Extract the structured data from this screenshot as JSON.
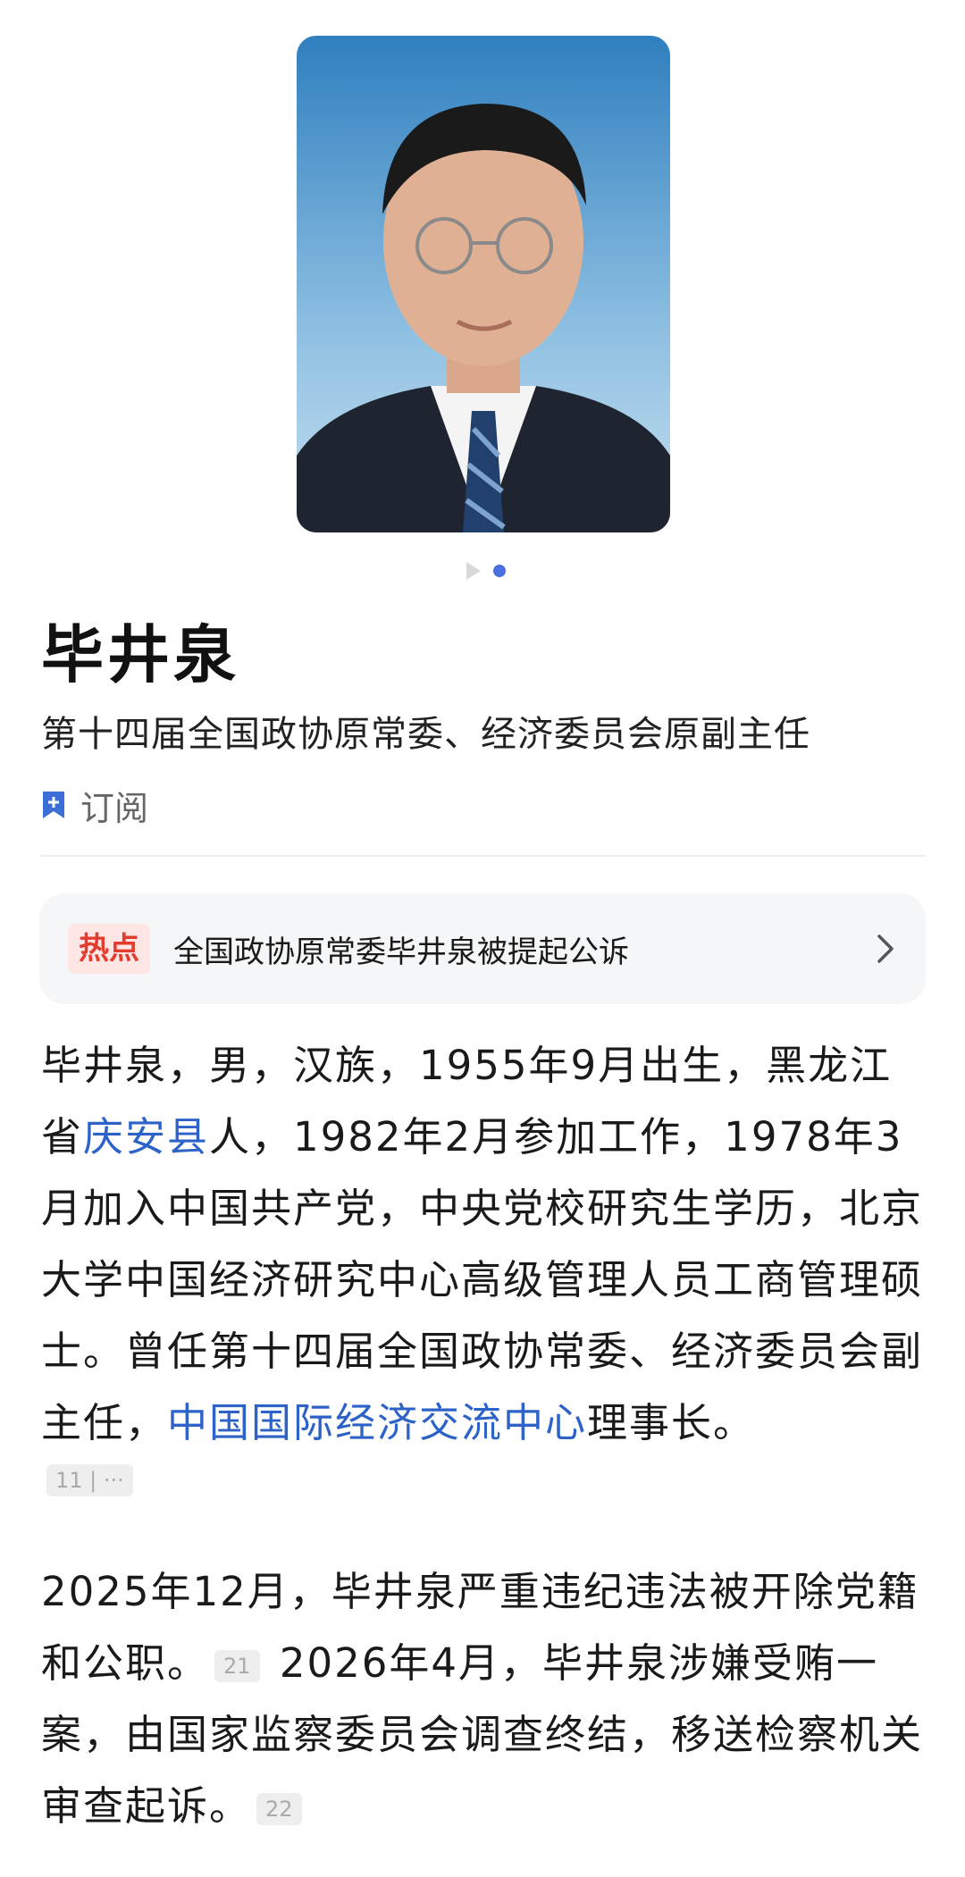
{
  "profile": {
    "name": "毕井泉",
    "subtitle": "第十四届全国政协原常委、经济委员会原副主任",
    "subscribe_label": "订阅"
  },
  "photo": {
    "icon": "portrait-photo"
  },
  "carousel": {
    "icons": [
      "play-icon",
      "dot-active"
    ]
  },
  "hot": {
    "badge": "热点",
    "text": "全国政协原常委毕井泉被提起公诉"
  },
  "bio": {
    "p1_a": "毕井泉，男，汉族，1955年9月出生，黑龙江省",
    "p1_link1": "庆安县",
    "p1_b": "人，1982年2月参加工作，1978年3月加入中国共产党，中央党校研究生学历，北京大学中国经济研究中心高级管理人员工商管理硕士。曾任第十四届全国政协常委、经济委员会副主任，",
    "p1_link2": "中国国际经济交流中心",
    "p1_c": "理事长。",
    "p1_ref": "11 | ···",
    "p2_a": "2025年12月，毕井泉严重违纪违法被开除党籍和公职。",
    "p2_ref1": "21",
    "p2_b": " 2026年4月，毕井泉涉嫌受贿一案，由国家监察委员会调查终结，移送检察机关审查起诉。",
    "p2_ref2": "22"
  },
  "colors": {
    "link": "#2d63c8",
    "hot_badge_text": "#e33b2e",
    "hot_badge_bg": "#fde6e4",
    "card_bg": "#f5f6f7",
    "carousel_active": "#4a6fe0"
  }
}
